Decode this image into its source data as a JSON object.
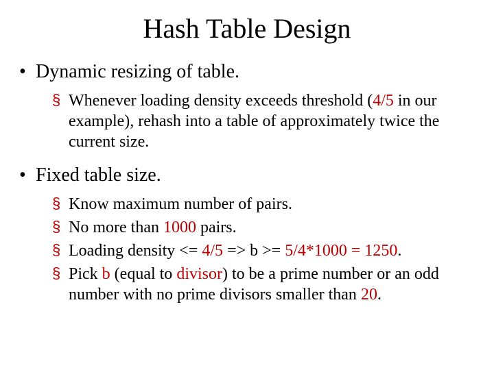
{
  "title": "Hash Table Design",
  "bullets": {
    "b1": "Dynamic resizing of table.",
    "b1_sub1_a": "Whenever loading density exceeds threshold (",
    "b1_sub1_hl": "4/5",
    "b1_sub1_b": " in our example), rehash into a table of approximately twice the current size.",
    "b2": "Fixed table size.",
    "b2_sub1": "Know maximum number of pairs.",
    "b2_sub2_a": "No more than ",
    "b2_sub2_hl": "1000",
    "b2_sub2_b": " pairs.",
    "b2_sub3_a": "Loading density <= ",
    "b2_sub3_hl1": "4/5",
    "b2_sub3_b": " => b >= ",
    "b2_sub3_hl2": "5/4*1000 = 1250",
    "b2_sub3_c": ".",
    "b2_sub4_a": "Pick ",
    "b2_sub4_hl1": "b",
    "b2_sub4_b": " (equal to ",
    "b2_sub4_hl2": "divisor",
    "b2_sub4_c": ") to be a prime number or an odd number with no prime divisors smaller than ",
    "b2_sub4_hl3": "20",
    "b2_sub4_d": "."
  }
}
